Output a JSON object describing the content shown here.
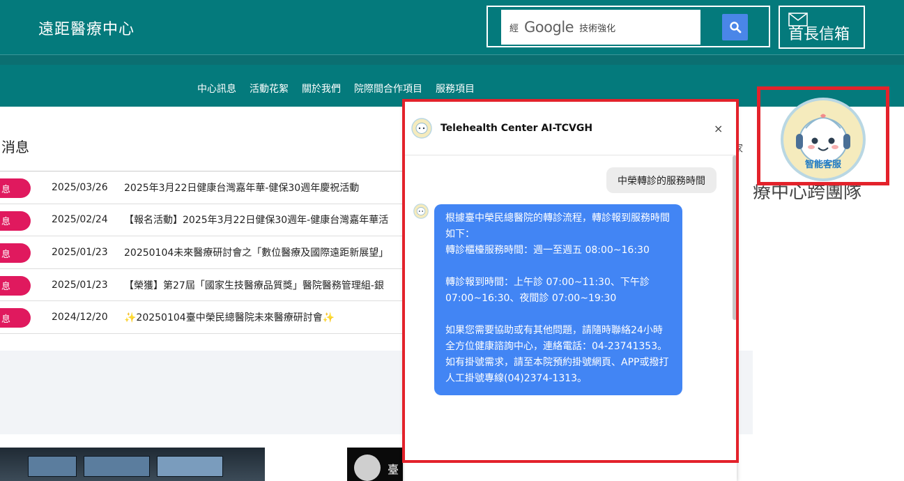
{
  "header": {
    "site_title": "遠距醫療中心",
    "search": {
      "prefix": "經",
      "brand": "Google",
      "suffix": "技術強化"
    },
    "mailbox_label": "首長信箱"
  },
  "nav": {
    "items": [
      {
        "label": "中心訊息"
      },
      {
        "label": "活動花絮"
      },
      {
        "label": "關於我們"
      },
      {
        "label": "院際間合作項目"
      },
      {
        "label": "服務項目"
      }
    ]
  },
  "news": {
    "title": "消息",
    "rows": [
      {
        "badge": "息",
        "date": "2025/03/26",
        "text": "2025年3月22日健康台灣嘉年華-健保30週年慶祝活動"
      },
      {
        "badge": "息",
        "date": "2025/02/24",
        "text": "【報名活動】2025年3月22日健保30週年-健康台灣嘉年華活"
      },
      {
        "badge": "息",
        "date": "2025/01/23",
        "text": "20250104未來醫療研討會之「數位醫療及國際遠距新展望」"
      },
      {
        "badge": "息",
        "date": "2025/01/23",
        "text": "【榮獲】第27屆「國家生技醫療品質獎」醫院醫務管理組-銀"
      },
      {
        "badge": "息",
        "date": "2024/12/20",
        "text": "✨20250104臺中榮民總醫院未來醫療研討會✨"
      }
    ]
  },
  "side": {
    "fragment": "家",
    "team_text": "療中心跨團隊",
    "assistant_label": "智能客服",
    "photo_text": "臺"
  },
  "chat": {
    "title": "Telehealth Center AI-TCVGH",
    "close_glyph": "×",
    "user_message": "中榮轉診的服務時間",
    "bot_message": {
      "p1": "根據臺中榮民總醫院的轉診流程，轉診報到服務時間如下：",
      "p2": "轉診櫃檯服務時間：週一至週五 08:00~16:30",
      "p3": "轉診報到時間：上午診 07:00~11:30、下午診 07:00~16:30、夜間診 07:00~19:30",
      "p4": "如果您需要協助或有其他問題，請隨時聯絡24小時全方位健康諮詢中心，連絡電話：04-23741353。",
      "p5": "如有掛號需求，請至本院預約掛號網頁、APP或撥打人工掛號專線(04)2374-1313。"
    }
  },
  "colors": {
    "header_teal": "#047a7c",
    "badge_pink": "#e0195e",
    "chat_blue": "#4285f4",
    "highlight_red": "#e3222b"
  }
}
